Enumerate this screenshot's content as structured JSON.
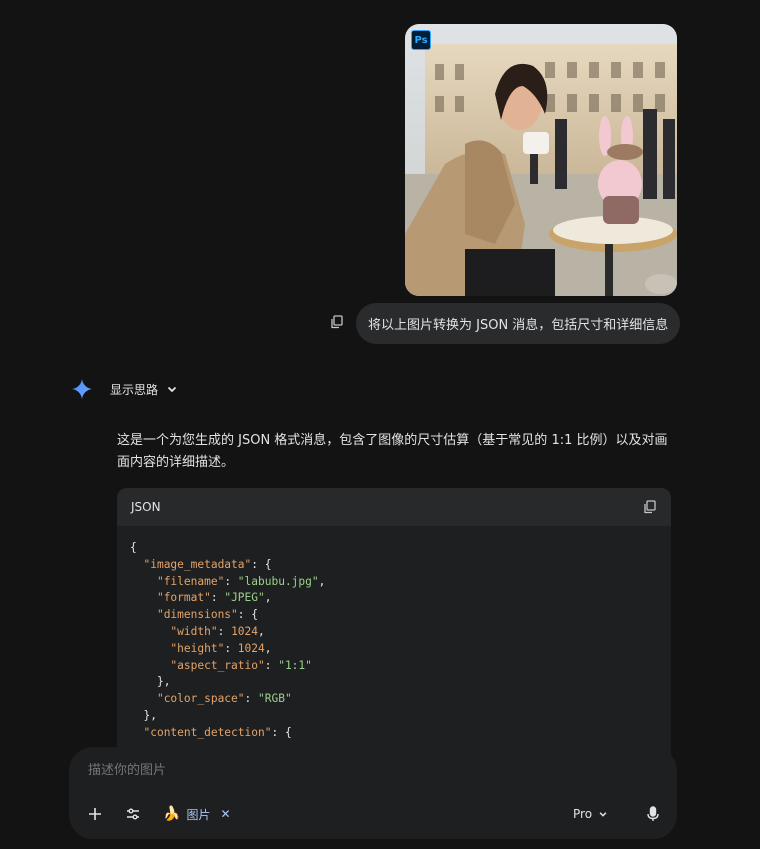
{
  "user_message": {
    "image_badge": "Ps",
    "text": "将以上图片转换为 JSON 消息，包括尺寸和详细信息"
  },
  "response": {
    "thinking_label": "显示思路",
    "intro": "这是一个为您生成的 JSON 格式消息，包含了图像的尺寸估算（基于常见的 1:1 比例）以及对画面内容的详细描述。",
    "code_block": {
      "language": "JSON",
      "lines": [
        {
          "indent": 0,
          "key": "",
          "value": "",
          "text": "{"
        },
        {
          "indent": 1,
          "key": "\"image_metadata\"",
          "value": "",
          "text": ": {"
        },
        {
          "indent": 2,
          "key": "\"filename\"",
          "value": "\"labubu.jpg\"",
          "text": ","
        },
        {
          "indent": 2,
          "key": "\"format\"",
          "value": "\"JPEG\"",
          "text": ","
        },
        {
          "indent": 2,
          "key": "\"dimensions\"",
          "value": "",
          "text": ": {"
        },
        {
          "indent": 3,
          "key": "\"width\"",
          "value": "1024",
          "text": ","
        },
        {
          "indent": 3,
          "key": "\"height\"",
          "value": "1024",
          "text": ","
        },
        {
          "indent": 3,
          "key": "\"aspect_ratio\"",
          "value": "\"1:1\"",
          "text": ""
        },
        {
          "indent": 2,
          "key": "",
          "value": "",
          "text": "},"
        },
        {
          "indent": 2,
          "key": "\"color_space\"",
          "value": "\"RGB\"",
          "text": ""
        },
        {
          "indent": 1,
          "key": "",
          "value": "",
          "text": "},"
        },
        {
          "indent": 1,
          "key": "\"content_detection\"",
          "value": "",
          "text": ": {"
        }
      ]
    }
  },
  "composer": {
    "placeholder": "描述你的图片",
    "chip_label": "图片",
    "chip_close": "✕",
    "model_label": "Pro"
  },
  "colors": {
    "background": "#131314",
    "bubble": "#2a2b2d",
    "code_bg": "#1e1f20",
    "json_key": "#e3a36a",
    "json_string": "#9bd18a",
    "accent": "#a8c7fa"
  },
  "icons": [
    "photoshop-badge-icon",
    "copy-icon",
    "gemini-spark-icon",
    "chevron-down-icon",
    "plus-icon",
    "tune-icon",
    "banana-icon",
    "close-icon",
    "mic-icon"
  ]
}
